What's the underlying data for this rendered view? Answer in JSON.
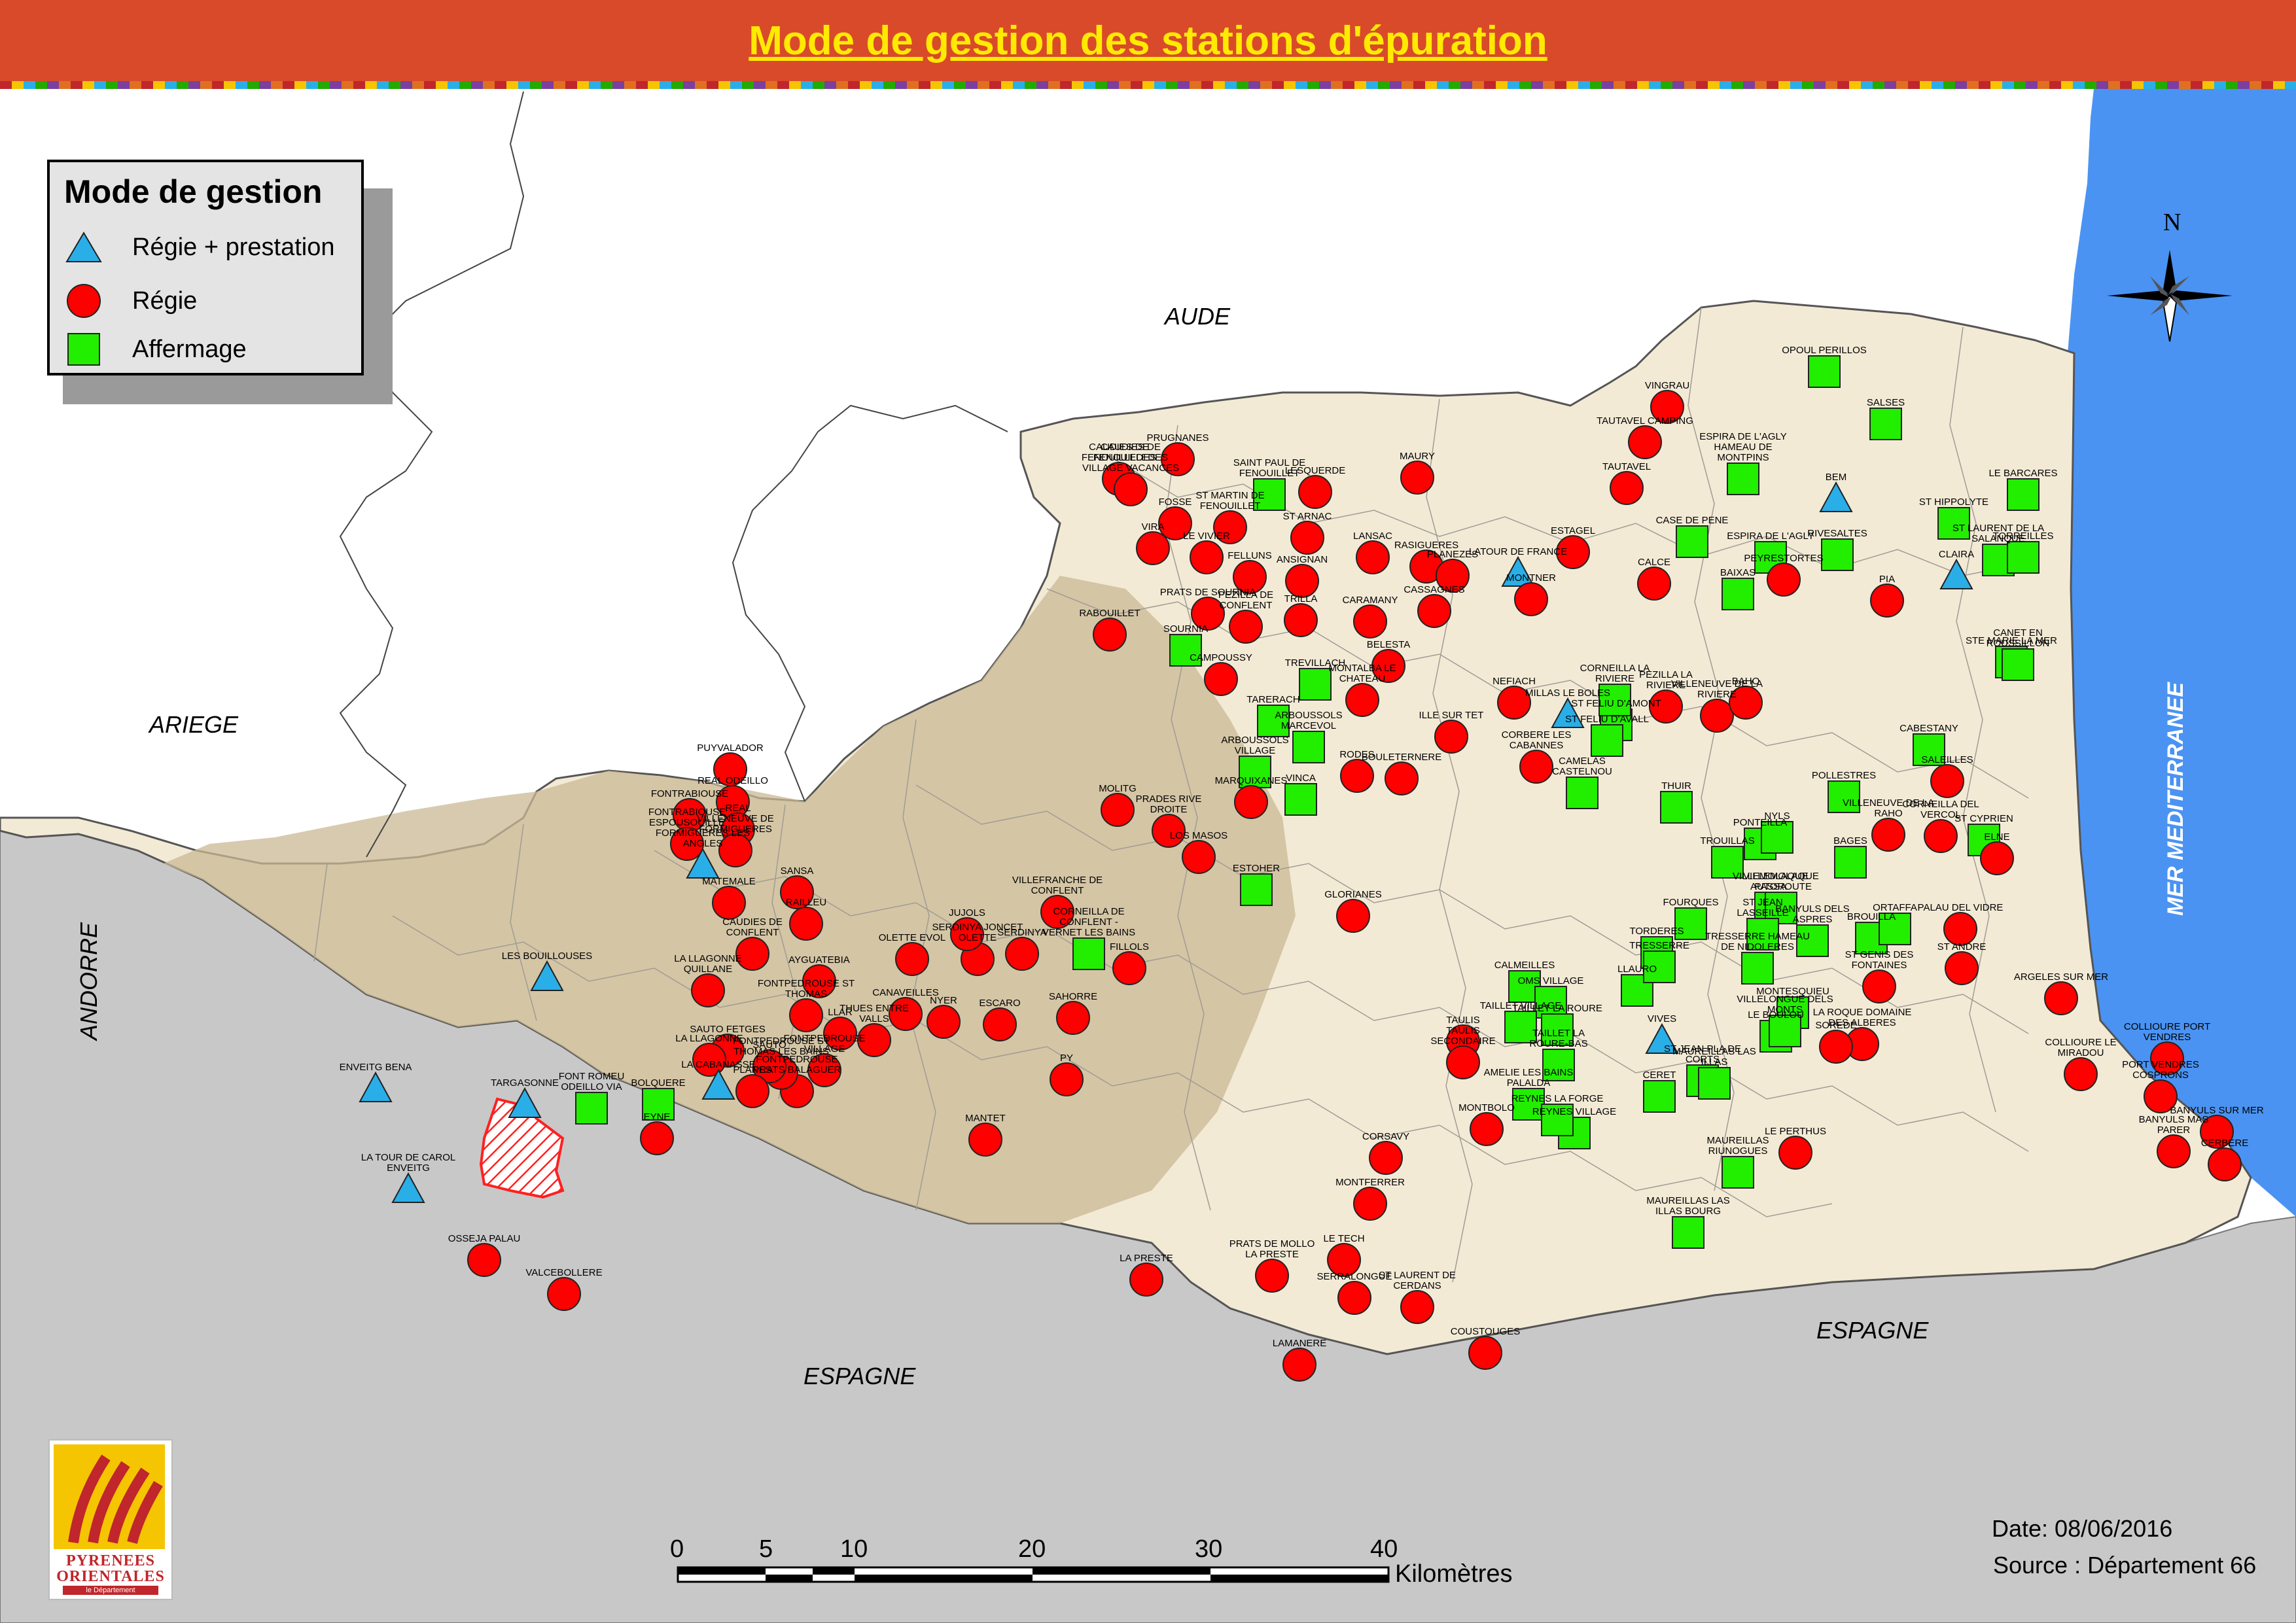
{
  "title": "Mode de gestion des stations d'épuration",
  "legend": {
    "title": "Mode de gestion",
    "items": [
      {
        "label": "Régie + prestation",
        "symbol": "triangle",
        "color": "#2aaee8"
      },
      {
        "label": "Régie",
        "symbol": "circle",
        "color": "#ff0000"
      },
      {
        "label": "Affermage",
        "symbol": "square",
        "color": "#22ee00"
      }
    ]
  },
  "colors": {
    "title_bg": "#d94a2a",
    "title_text": "#ffea00",
    "territory": "#f3ead6",
    "mountain_shade": "#c9b894",
    "neighbor_spain_andorra": "#c8c8c8",
    "sea": "#4a93f2",
    "regie": "#ff0000",
    "affermage": "#22ee00",
    "regie_prestation": "#2aaee8"
  },
  "region_labels": {
    "aude": "AUDE",
    "ariege": "ARIEGE",
    "andorre": "ANDORRE",
    "espagne_west": "ESPAGNE",
    "espagne_east": "ESPAGNE",
    "mer": "MER MEDITERRANEE"
  },
  "compass": {
    "north": "N"
  },
  "scale_bar": {
    "ticks": [
      "0",
      "5",
      "10",
      "20",
      "30",
      "40"
    ],
    "unit": "Kilomètres"
  },
  "date": "Date: 08/06/2016",
  "source": "Source : Département 66",
  "logo": {
    "name": "PYRENEES ORIENTALES",
    "sub": "le Département"
  },
  "stations": [
    {
      "name": "CAUDIES DE FENOUILLEDES",
      "type": "regie"
    },
    {
      "name": "CAUDIES DE FENOUILLEDES VILLAGE VACANCES",
      "type": "regie"
    },
    {
      "name": "PRUGNANES",
      "type": "regie"
    },
    {
      "name": "SAINT PAUL DE FENOUILLET",
      "type": "affermage"
    },
    {
      "name": "LESQUERDE",
      "type": "regie"
    },
    {
      "name": "MAURY",
      "type": "regie"
    },
    {
      "name": "FOSSE",
      "type": "regie"
    },
    {
      "name": "ST MARTIN DE FENOUILLET",
      "type": "regie"
    },
    {
      "name": "VIRA",
      "type": "regie"
    },
    {
      "name": "LE VIVIER",
      "type": "regie"
    },
    {
      "name": "ST ARNAC",
      "type": "regie"
    },
    {
      "name": "LANSAC",
      "type": "regie"
    },
    {
      "name": "RASIGUERES",
      "type": "regie"
    },
    {
      "name": "PLANEZES",
      "type": "regie"
    },
    {
      "name": "FELLUNS",
      "type": "regie"
    },
    {
      "name": "ANSIGNAN",
      "type": "regie"
    },
    {
      "name": "PRATS DE SOURNIA",
      "type": "regie"
    },
    {
      "name": "PEZILLA DE CONFLENT",
      "type": "regie"
    },
    {
      "name": "TRILLA",
      "type": "regie"
    },
    {
      "name": "CARAMANY",
      "type": "regie"
    },
    {
      "name": "CASSAGNES",
      "type": "regie"
    },
    {
      "name": "RABOUILLET",
      "type": "regie"
    },
    {
      "name": "SOURNIA",
      "type": "affermage"
    },
    {
      "name": "CAMPOUSSY",
      "type": "regie"
    },
    {
      "name": "TREVILLACH",
      "type": "affermage"
    },
    {
      "name": "BELESTA",
      "type": "regie"
    },
    {
      "name": "TARERACH",
      "type": "affermage"
    },
    {
      "name": "MONTALBA LE CHATEAU",
      "type": "regie"
    },
    {
      "name": "ILLE SUR TET",
      "type": "regie"
    },
    {
      "name": "ARBOUSSOLS MARCEVOL",
      "type": "affermage"
    },
    {
      "name": "ARBOUSSOLS VILLAGE",
      "type": "affermage"
    },
    {
      "name": "MARQUIXANES",
      "type": "regie"
    },
    {
      "name": "VINCA",
      "type": "affermage"
    },
    {
      "name": "RODES",
      "type": "regie"
    },
    {
      "name": "BOULETERNERE",
      "type": "regie"
    },
    {
      "name": "MOLITG",
      "type": "regie"
    },
    {
      "name": "PRADES RIVE DROITE",
      "type": "regie"
    },
    {
      "name": "LOS MASOS",
      "type": "regie"
    },
    {
      "name": "ESTOHER",
      "type": "affermage"
    },
    {
      "name": "GLORIANES",
      "type": "regie"
    },
    {
      "name": "VILLEFRANCHE DE CONFLENT",
      "type": "regie"
    },
    {
      "name": "CORNEILLA DE CONFLENT - VERNET LES BAINS",
      "type": "affermage"
    },
    {
      "name": "FILLOLS",
      "type": "regie"
    },
    {
      "name": "SAHORRE",
      "type": "regie"
    },
    {
      "name": "PY",
      "type": "regie"
    },
    {
      "name": "SERDINYA",
      "type": "regie"
    },
    {
      "name": "SERDINYA JONCET OLETTE",
      "type": "regie"
    },
    {
      "name": "JUJOLS",
      "type": "regie"
    },
    {
      "name": "OLETTE EVOL",
      "type": "regie"
    },
    {
      "name": "NYER",
      "type": "regie"
    },
    {
      "name": "CANAVEILLES",
      "type": "regie"
    },
    {
      "name": "ESCARO",
      "type": "regie"
    },
    {
      "name": "THUES ENTRE VALLS",
      "type": "regie"
    },
    {
      "name": "LLAR",
      "type": "regie"
    },
    {
      "name": "MANTET",
      "type": "regie"
    },
    {
      "name": "FONTPEDROUSE VILLAGE",
      "type": "regie"
    },
    {
      "name": "FONTPEDROUSE PRATS BALAGUER",
      "type": "regie"
    },
    {
      "name": "FONTPEDROUSE ST THOMAS LES BAINS",
      "type": "regie"
    },
    {
      "name": "FONTPEDROUSE ST THOMAS",
      "type": "regie"
    },
    {
      "name": "AYGUATEBIA",
      "type": "regie"
    },
    {
      "name": "CAUDIES DE CONFLENT",
      "type": "regie"
    },
    {
      "name": "RAILLEU",
      "type": "regie"
    },
    {
      "name": "SANSA",
      "type": "regie"
    },
    {
      "name": "MATEMALE",
      "type": "regie"
    },
    {
      "name": "PUYVALADOR",
      "type": "regie"
    },
    {
      "name": "REAL ODEILLO",
      "type": "regie"
    },
    {
      "name": "REAL",
      "type": "regie"
    },
    {
      "name": "FONTRABIOUSE",
      "type": "regie"
    },
    {
      "name": "FONTRABIOUSE ESPOUSOUILLE",
      "type": "regie"
    },
    {
      "name": "VILLENEUVE DE FORMIGUERES",
      "type": "regie"
    },
    {
      "name": "FORMIGUERES LES ANGLES",
      "type": "regie_prestation"
    },
    {
      "name": "LES BOUILLOUSES",
      "type": "regie_prestation"
    },
    {
      "name": "LA LLAGONNE QUILLANE",
      "type": "regie"
    },
    {
      "name": "SAUTO FETGES",
      "type": "regie"
    },
    {
      "name": "LA LLAGONNE",
      "type": "regie"
    },
    {
      "name": "SAUTO",
      "type": "regie"
    },
    {
      "name": "PLANES",
      "type": "regie"
    },
    {
      "name": "LA CABANASSE",
      "type": "regie_prestation"
    },
    {
      "name": "TARGASONNE",
      "type": "regie_prestation"
    },
    {
      "name": "FONT ROMEU ODEILLO VIA",
      "type": "affermage"
    },
    {
      "name": "BOLQUERE",
      "type": "affermage"
    },
    {
      "name": "EYNE",
      "type": "regie"
    },
    {
      "name": "ENVEITG BENA",
      "type": "regie_prestation"
    },
    {
      "name": "LA TOUR DE CAROL ENVEITG",
      "type": "regie_prestation"
    },
    {
      "name": "OSSEJA PALAU",
      "type": "regie"
    },
    {
      "name": "VALCEBOLLERE",
      "type": "regie"
    },
    {
      "name": "CORSAVY",
      "type": "regie"
    },
    {
      "name": "MONTFERRER",
      "type": "regie"
    },
    {
      "name": "LE TECH",
      "type": "regie"
    },
    {
      "name": "SERRALONGUE",
      "type": "regie"
    },
    {
      "name": "LAMANERE",
      "type": "regie"
    },
    {
      "name": "PRATS DE MOLLO LA PRESTE",
      "type": "regie"
    },
    {
      "name": "LA PRESTE",
      "type": "regie"
    },
    {
      "name": "ST LAURENT DE CERDANS",
      "type": "regie"
    },
    {
      "name": "COUSTOUGES",
      "type": "regie"
    },
    {
      "name": "MONTBOLO",
      "type": "regie"
    },
    {
      "name": "TAULIS",
      "type": "regie"
    },
    {
      "name": "TAULIS SECONDAIRE",
      "type": "regie"
    },
    {
      "name": "CALMEILLES",
      "type": "affermage"
    },
    {
      "name": "OMS VILLAGE",
      "type": "affermage"
    },
    {
      "name": "TAILLET VILLAGE",
      "type": "affermage"
    },
    {
      "name": "TAILLET LA ROURE",
      "type": "affermage"
    },
    {
      "name": "TAILLET LA ROURE-BAS",
      "type": "affermage"
    },
    {
      "name": "AMELIE LES BAINS PALALDA",
      "type": "affermage"
    },
    {
      "name": "REYNES VILLAGE",
      "type": "affermage"
    },
    {
      "name": "REYNES LA FORGE",
      "type": "affermage"
    },
    {
      "name": "FOURQUES",
      "type": "affermage"
    },
    {
      "name": "TORDERES",
      "type": "affermage"
    },
    {
      "name": "LLAURO",
      "type": "affermage"
    },
    {
      "name": "VIVES",
      "type": "regie_prestation"
    },
    {
      "name": "CERET",
      "type": "affermage"
    },
    {
      "name": "ST JEAN PLA DE CORTS",
      "type": "affermage"
    },
    {
      "name": "MAUREILLAS LAS ILLAS",
      "type": "affermage"
    },
    {
      "name": "MAUREILLAS LAS ILLAS BOURG",
      "type": "affermage"
    },
    {
      "name": "MAUREILLAS RIUNOGUES",
      "type": "affermage"
    },
    {
      "name": "LE PERTHUS",
      "type": "regie"
    },
    {
      "name": "TRESSERRE",
      "type": "affermage"
    },
    {
      "name": "TRESSERRE HAMEAU DE NIDOLERES",
      "type": "affermage"
    },
    {
      "name": "LE BOULOU",
      "type": "affermage"
    },
    {
      "name": "VILLEMOLAQUE PASSA",
      "type": "affermage"
    },
    {
      "name": "VILLEMOLAQUE AUTOROUTE",
      "type": "affermage"
    },
    {
      "name": "ST JEAN LASSEILLE",
      "type": "affermage"
    },
    {
      "name": "BANYULS DELS ASPRES",
      "type": "affermage"
    },
    {
      "name": "BROUILLA",
      "type": "affermage"
    },
    {
      "name": "ORTAFFA",
      "type": "affermage"
    },
    {
      "name": "MONTESQUIEU",
      "type": "affermage"
    },
    {
      "name": "VILLELONGUE DELS MONTS",
      "type": "affermage"
    },
    {
      "name": "LA ROQUE DOMAINE DES ALBERES",
      "type": "regie"
    },
    {
      "name": "ST GENIS DES FONTAINES",
      "type": "regie"
    },
    {
      "name": "ST ANDRE",
      "type": "regie"
    },
    {
      "name": "PALAU DEL VIDRE",
      "type": "regie"
    },
    {
      "name": "SOREDE",
      "type": "regie"
    },
    {
      "name": "ARGELES SUR MER",
      "type": "regie"
    },
    {
      "name": "COLLIOURE PORT VENDRES",
      "type": "regie"
    },
    {
      "name": "COLLIOURE LE MIRADOU",
      "type": "regie"
    },
    {
      "name": "PORT VENDRES COSPRONS",
      "type": "regie"
    },
    {
      "name": "BANYULS SUR MER",
      "type": "regie"
    },
    {
      "name": "BANYULS MAS PARER",
      "type": "regie"
    },
    {
      "name": "CERBERE",
      "type": "regie"
    },
    {
      "name": "VINGRAU",
      "type": "regie"
    },
    {
      "name": "TAUTAVEL CAMPING",
      "type": "regie"
    },
    {
      "name": "TAUTAVEL",
      "type": "regie"
    },
    {
      "name": "OPOUL PERILLOS",
      "type": "affermage"
    },
    {
      "name": "SALSES",
      "type": "affermage"
    },
    {
      "name": "ESPIRA DE L'AGLY HAMEAU DE MONTPINS",
      "type": "affermage"
    },
    {
      "name": "CASE DE PENE",
      "type": "affermage"
    },
    {
      "name": "ESPIRA DE L'AGLY",
      "type": "affermage"
    },
    {
      "name": "BAIXAS",
      "type": "affermage"
    },
    {
      "name": "PEYRESTORTES",
      "type": "regie"
    },
    {
      "name": "RIVESALTES",
      "type": "affermage"
    },
    {
      "name": "PIA",
      "type": "regie"
    },
    {
      "name": "CALCE",
      "type": "regie"
    },
    {
      "name": "ESTAGEL",
      "type": "regie"
    },
    {
      "name": "LATOUR DE FRANCE",
      "type": "regie_prestation"
    },
    {
      "name": "MONTNER",
      "type": "regie"
    },
    {
      "name": "BEM",
      "type": "regie_prestation"
    },
    {
      "name": "ST HIPPOLYTE",
      "type": "affermage"
    },
    {
      "name": "LE BARCARES",
      "type": "affermage"
    },
    {
      "name": "CLAIRA",
      "type": "regie_prestation"
    },
    {
      "name": "ST LAURENT DE LA SALANQUE",
      "type": "affermage"
    },
    {
      "name": "TORREILLES",
      "type": "affermage"
    },
    {
      "name": "STE MARIE LA MER",
      "type": "affermage"
    },
    {
      "name": "CANET EN ROUSSILLON",
      "type": "affermage"
    },
    {
      "name": "NEFIACH",
      "type": "regie"
    },
    {
      "name": "MILLAS LE BOLES",
      "type": "regie_prestation"
    },
    {
      "name": "ST FELIU D'AMONT",
      "type": "affermage"
    },
    {
      "name": "ST FELIU D'AVALL",
      "type": "affermage"
    },
    {
      "name": "CORNEILLA LA RIVIERE",
      "type": "affermage"
    },
    {
      "name": "PEZILLA LA RIVIERE",
      "type": "regie"
    },
    {
      "name": "VILLENEUVE DE LA RIVIERE",
      "type": "regie"
    },
    {
      "name": "BAHO",
      "type": "regie"
    },
    {
      "name": "CORBERE LES CABANNES",
      "type": "regie"
    },
    {
      "name": "CAMELAS CASTELNOU",
      "type": "affermage"
    },
    {
      "name": "THUIR",
      "type": "affermage"
    },
    {
      "name": "TROUILLAS",
      "type": "affermage"
    },
    {
      "name": "PONTEILLA",
      "type": "affermage"
    },
    {
      "name": "NYLS",
      "type": "affermage"
    },
    {
      "name": "POLLESTRES",
      "type": "affermage"
    },
    {
      "name": "BAGES",
      "type": "affermage"
    },
    {
      "name": "VILLENEUVE DE LA RAHO",
      "type": "regie"
    },
    {
      "name": "CORNEILLA DEL VERCOL",
      "type": "regie"
    },
    {
      "name": "CABESTANY",
      "type": "affermage"
    },
    {
      "name": "SALEILLES",
      "type": "regie"
    },
    {
      "name": "ST CYPRIEN",
      "type": "affermage"
    },
    {
      "name": "ELNE",
      "type": "regie"
    }
  ]
}
